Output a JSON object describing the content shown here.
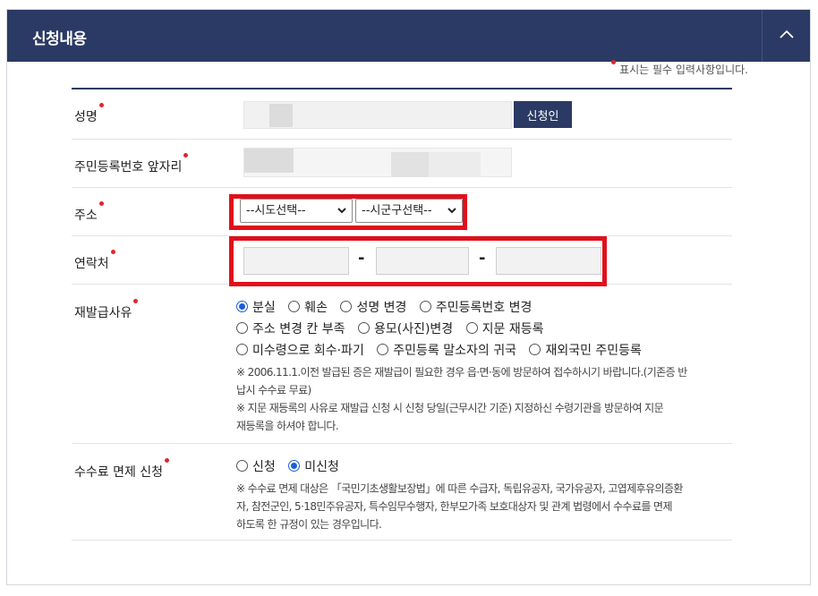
{
  "panel": {
    "title": "신청내용"
  },
  "required_note": "표시는 필수 입력사항입니다.",
  "fields": {
    "name": {
      "label": "성명",
      "button": "신청인"
    },
    "rrn": {
      "label": "주민등록번호 앞자리"
    },
    "address": {
      "label": "주소",
      "sido_selected": "--시도선택--",
      "sigungu_selected": "--시군구선택--"
    },
    "phone": {
      "label": "연락처",
      "separator": "-"
    },
    "reason": {
      "label": "재발급사유",
      "options": [
        "분실",
        "훼손",
        "성명 변경",
        "주민등록번호 변경",
        "주소 변경 칸 부족",
        "용모(사진)변경",
        "지문 재등록",
        "미수령으로 회수·파기",
        "주민등록 말소자의 귀국",
        "재외국민 주민등록"
      ],
      "selected": "분실",
      "notes": [
        "※ 2006.11.1.이전 발급된 증은 재발급이 필요한 경우 읍·면·동에 방문하여 접수하시기 바랍니다.(기존증 반",
        "납시 수수료 무료)",
        "※ 지문 재등록의 사유로 재발급 신청 시 신청 당일(근무시간 기준) 지정하신 수령기관을 방문하여 지문",
        "재등록을 하셔야 합니다."
      ]
    },
    "fee": {
      "label": "수수료 면제 신청",
      "options": [
        "신청",
        "미신청"
      ],
      "selected": "미신청",
      "notes": [
        "※ 수수료 면제 대상은 「국민기초생활보장법」에 따른 수급자, 독립유공자, 국가유공자, 고엽제후유의증환",
        "자, 참전군인, 5·18민주유공자, 특수임무수행자, 한부모가족 보호대상자 및 관계 법령에서 수수료를 면제",
        "하도록 한 규정이 있는 경우입니다."
      ]
    }
  },
  "colors": {
    "header": "#2b3a64",
    "required_dot": "#e0262b",
    "highlight": "#e0101b",
    "radio_on": "#1a5fd6"
  }
}
